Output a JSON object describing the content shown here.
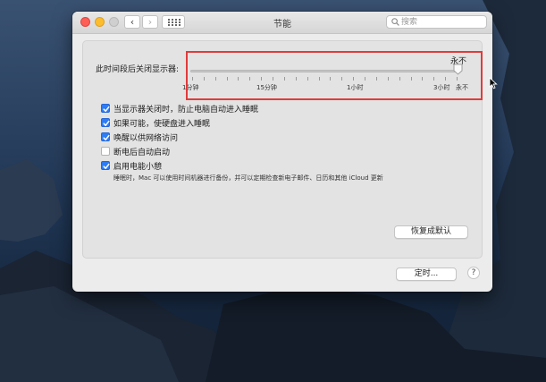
{
  "window": {
    "title": "节能",
    "search_placeholder": "搜索"
  },
  "display_sleep": {
    "label": "此时间段后关闭显示器:",
    "current_value": "永不",
    "scale_labels": [
      "1分钟",
      "15分钟",
      "1小时",
      "3小时",
      "永不"
    ]
  },
  "options": [
    {
      "label": "当显示器关闭时，防止电脑自动进入睡眠",
      "checked": true
    },
    {
      "label": "如果可能，使硬盘进入睡眠",
      "checked": true
    },
    {
      "label": "唤醒以供网络访问",
      "checked": true
    },
    {
      "label": "断电后自动启动",
      "checked": false
    },
    {
      "label": "启用电能小憩",
      "checked": true
    }
  ],
  "power_nap_note": "睡眠时，Mac 可以使用时间机器进行备份，并可以定期检查新电子邮件、日历和其他 iCloud 更新",
  "buttons": {
    "restore_defaults": "恢复成默认",
    "schedule": "定时...",
    "help": "?"
  },
  "colors": {
    "checkbox_checked": "#2e7cf6",
    "highlight_box": "#e13b3b",
    "close": "#fd5f57",
    "minimize": "#fdbc2e"
  }
}
